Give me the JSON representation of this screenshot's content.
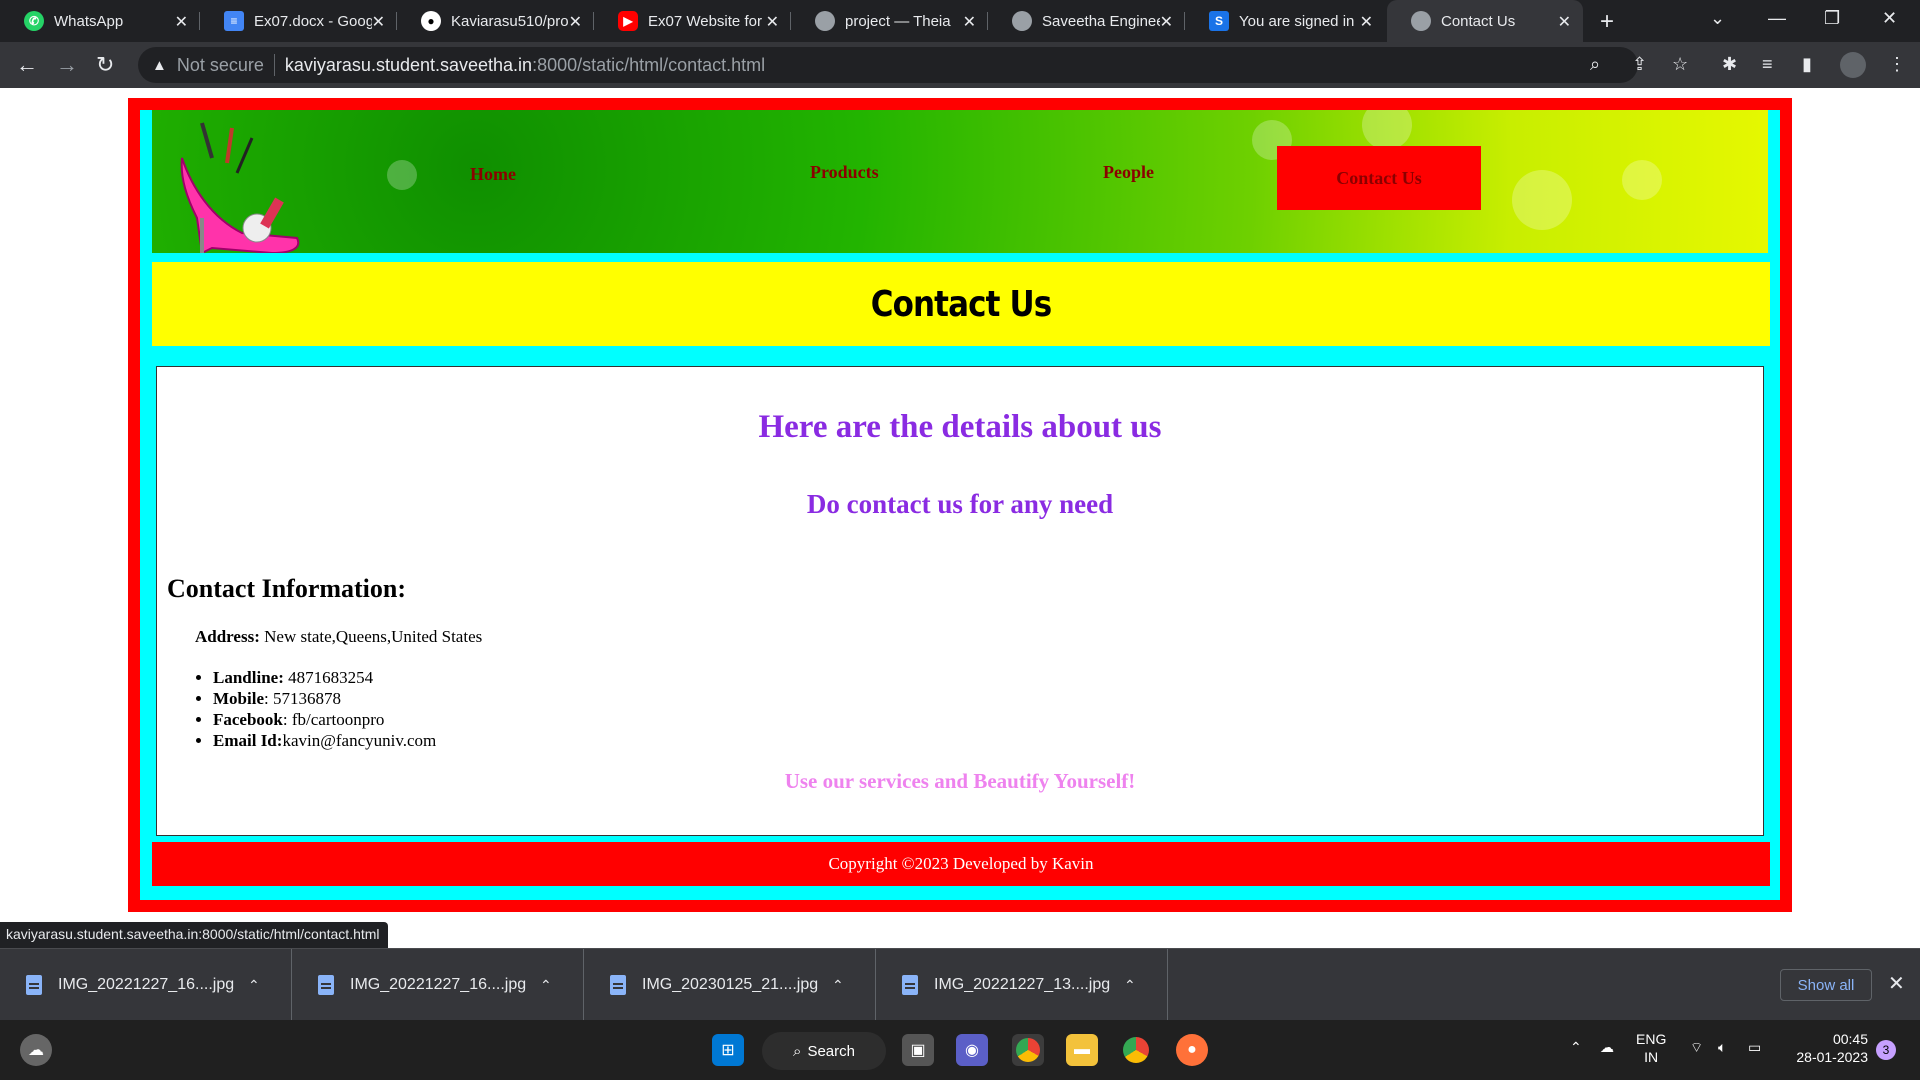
{
  "browser": {
    "tabs": [
      {
        "title": "WhatsApp",
        "icon": "whatsapp-icon",
        "color": "#25d366",
        "active": false
      },
      {
        "title": "Ex07.docx - Goog",
        "icon": "google-docs-icon",
        "color": "#4285f4",
        "active": false
      },
      {
        "title": "Kaviarasu510/pro",
        "icon": "github-icon",
        "color": "#ffffff",
        "active": false
      },
      {
        "title": "Ex07 Website for",
        "icon": "youtube-icon",
        "color": "#ff0000",
        "active": false
      },
      {
        "title": "project — Theia",
        "icon": "globe-icon",
        "color": "#9aa0a6",
        "active": false
      },
      {
        "title": "Saveetha Enginee",
        "icon": "globe-icon",
        "color": "#9aa0a6",
        "active": false
      },
      {
        "title": "You are signed in",
        "icon": "s-icon",
        "color": "#1a73e8",
        "active": false
      },
      {
        "title": "Contact Us",
        "icon": "globe-icon",
        "color": "#9aa0a6",
        "active": true
      }
    ],
    "security_label": "Not secure",
    "url_host": "kaviyarasu.student.saveetha.in",
    "url_path": ":8000/static/html/contact.html",
    "status_url": "kaviyarasu.student.saveetha.in:8000/static/html/contact.html"
  },
  "site": {
    "nav": {
      "home": "Home",
      "products": "Products",
      "people": "People",
      "contact": "Contact Us"
    },
    "page_title": "Contact Us",
    "heading_details": "Here are the details about us",
    "heading_contact": "Do contact us for any need",
    "info_heading": "Contact Information:",
    "address_label": "Address:",
    "address_value": " New state,Queens,United States",
    "contacts": [
      {
        "label": "Landline:",
        "value": " 4871683254"
      },
      {
        "label": "Mobile",
        "value": ": 57136878"
      },
      {
        "label": "Facebook",
        "value": ": fb/cartoonpro"
      },
      {
        "label": "Email Id:",
        "value": "kavin@fancyuniv.com"
      }
    ],
    "tagline": "Use our services and Beautify Yourself!",
    "footer": "Copyright ©2023 Developed by Kavin"
  },
  "downloads": {
    "items": [
      "IMG_20221227_16....jpg",
      "IMG_20221227_16....jpg",
      "IMG_20230125_21....jpg",
      "IMG_20221227_13....jpg"
    ],
    "show_all": "Show all"
  },
  "taskbar": {
    "search_label": "Search",
    "language_top": "ENG",
    "language_bottom": "IN",
    "time": "00:45",
    "date": "28-01-2023",
    "notification_count": "3"
  }
}
